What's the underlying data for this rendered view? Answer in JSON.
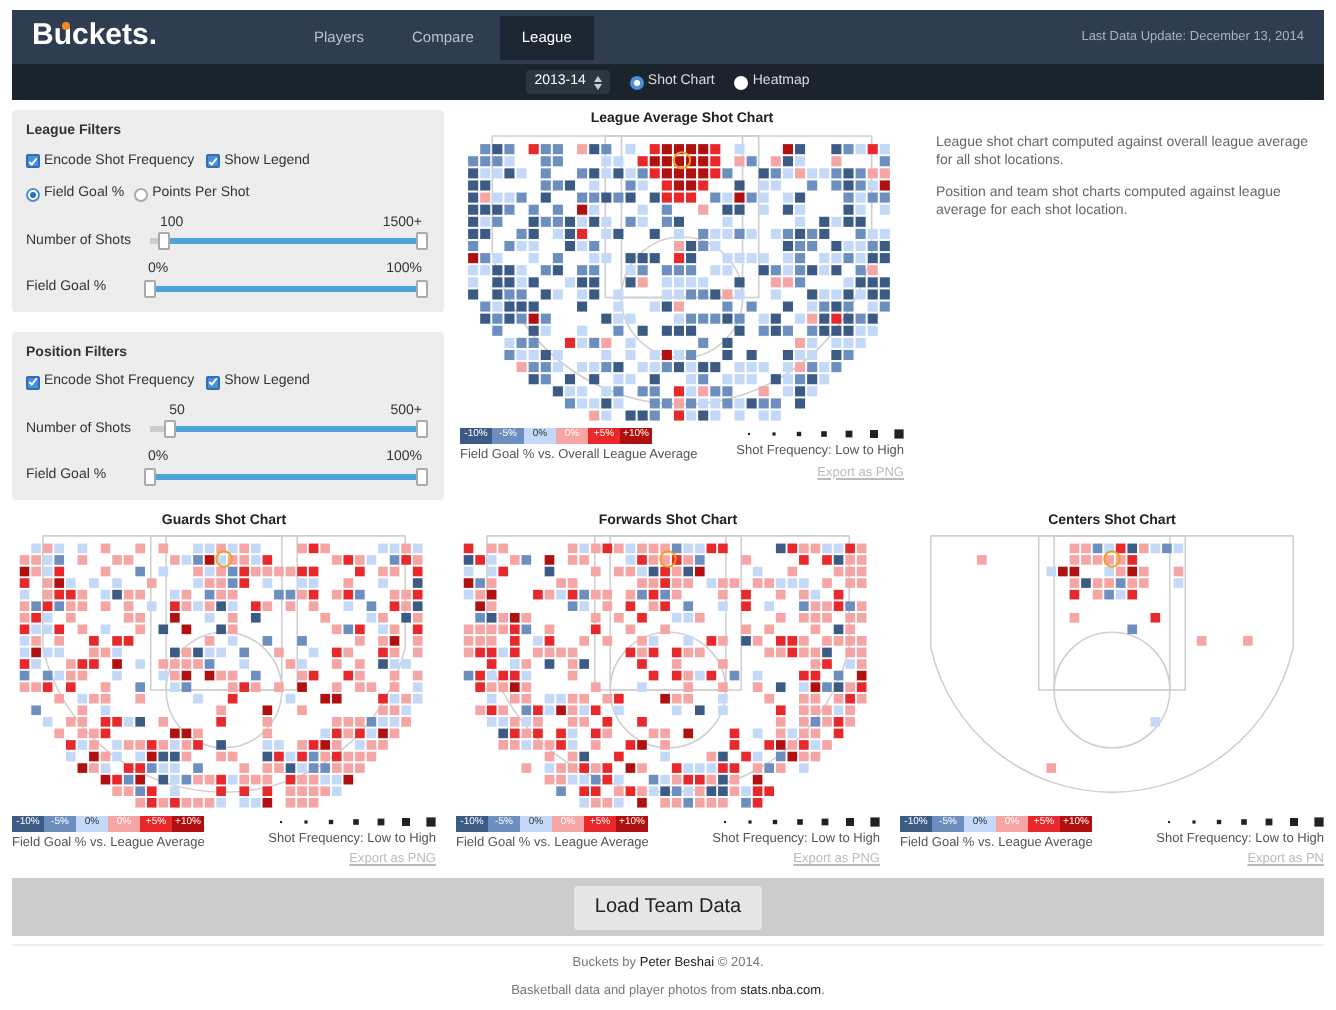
{
  "header": {
    "logo": "Buckets.",
    "last_update": "Last Data Update: December 13, 2014",
    "nav": [
      {
        "label": "Players",
        "selected": false
      },
      {
        "label": "Compare",
        "selected": false
      },
      {
        "label": "League",
        "selected": true
      }
    ]
  },
  "toolbar": {
    "season": "2013-14",
    "modes": [
      {
        "label": "Shot Chart",
        "selected": true
      },
      {
        "label": "Heatmap",
        "selected": false
      }
    ]
  },
  "filters": [
    {
      "title": "League Filters",
      "checkboxes": [
        {
          "label": "Encode Shot Frequency",
          "checked": true
        },
        {
          "label": "Show Legend",
          "checked": true
        }
      ],
      "metrics": [
        {
          "label": "Field Goal %",
          "selected": true
        },
        {
          "label": "Points Per Shot",
          "selected": false
        }
      ],
      "sliders": [
        {
          "label": "Number of Shots",
          "min_label": "100",
          "max_label": "1500+",
          "level": 0.95
        },
        {
          "label": "Field Goal %",
          "min_label": "0%",
          "max_label": "100%",
          "level": 1
        }
      ]
    },
    {
      "title": "Position Filters",
      "checkboxes": [
        {
          "label": "Encode Shot Frequency",
          "checked": true
        },
        {
          "label": "Show Legend",
          "checked": true
        }
      ],
      "sliders": [
        {
          "label": "Number of Shots",
          "min_label": "50",
          "max_label": "500+",
          "level": 0.93
        },
        {
          "label": "Field Goal %",
          "min_label": "0%",
          "max_label": "100%",
          "level": 1
        }
      ]
    }
  ],
  "league_chart": {
    "title": "League Average Shot Chart",
    "caption": "Field Goal % vs. Overall League Average",
    "frequency": "Shot Frequency: Low to High",
    "export": "Export as PNG",
    "legend": [
      {
        "label": "-10%",
        "color": "#3b5b85"
      },
      {
        "label": "-5%",
        "color": "#6d8fc0"
      },
      {
        "label": "0%",
        "color": "#c3d9f7"
      },
      {
        "label": "0%",
        "color": "#f6a5a5"
      },
      {
        "label": "+5%",
        "color": "#e8282a"
      },
      {
        "label": "+10%",
        "color": "#b0100f"
      }
    ]
  },
  "notes": [
    "League shot chart computed against overall league average for all shot locations.",
    "Position and team shot charts computed against league average for each shot location."
  ],
  "position_charts": [
    {
      "title": "Guards Shot Chart",
      "caption": "Field Goal % vs. League Average",
      "frequency": "Shot Frequency: Low to High",
      "export": "Export as PNG",
      "legend": [
        {
          "label": "-10%",
          "color": "#3b5b85"
        },
        {
          "label": "-5%",
          "color": "#6d8fc0"
        },
        {
          "label": "0%",
          "color": "#c3d9f7"
        },
        {
          "label": "0%",
          "color": "#f6a5a5"
        },
        {
          "label": "+5%",
          "color": "#e8282a"
        },
        {
          "label": "+10%",
          "color": "#b0100f"
        }
      ]
    },
    {
      "title": "Forwards Shot Chart",
      "caption": "Field Goal % vs. League Average",
      "frequency": "Shot Frequency: Low to High",
      "export": "Export as PNG",
      "legend": [
        {
          "label": "-10%",
          "color": "#3b5b85"
        },
        {
          "label": "-5%",
          "color": "#6d8fc0"
        },
        {
          "label": "0%",
          "color": "#c3d9f7"
        },
        {
          "label": "0%",
          "color": "#f6a5a5"
        },
        {
          "label": "+5%",
          "color": "#e8282a"
        },
        {
          "label": "+10%",
          "color": "#b0100f"
        }
      ]
    },
    {
      "title": "Centers Shot Chart",
      "caption": "Field Goal % vs. League Average",
      "frequency": "Shot Frequency: Low to High",
      "export": "Export as PN",
      "legend": [
        {
          "label": "-10%",
          "color": "#3b5b85"
        },
        {
          "label": "-5%",
          "color": "#6d8fc0"
        },
        {
          "label": "0%",
          "color": "#c3d9f7"
        },
        {
          "label": "0%",
          "color": "#f6a5a5"
        },
        {
          "label": "+5%",
          "color": "#e8282a"
        },
        {
          "label": "+10%",
          "color": "#b0100f"
        }
      ]
    }
  ],
  "load_button": "Load Team Data",
  "footer": [
    {
      "before": "Buckets by ",
      "link": "Peter Beshai",
      "after": " © 2014."
    },
    {
      "before": "Basketball data and player photos from ",
      "link": "stats.nba.com",
      "after": "."
    }
  ]
}
